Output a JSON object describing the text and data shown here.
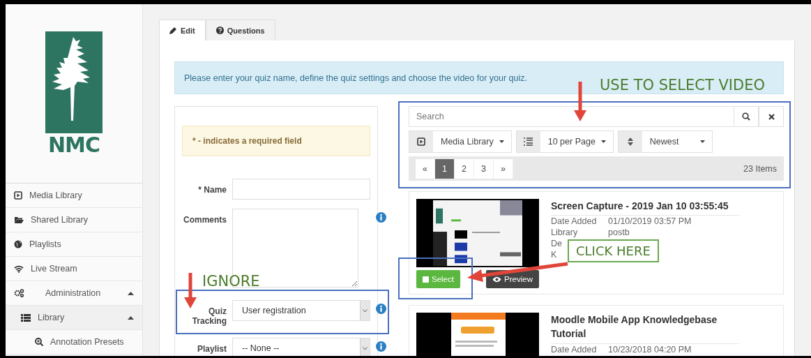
{
  "logo": {
    "text": "NMC"
  },
  "sidebar": {
    "items": [
      {
        "label": "Media Library"
      },
      {
        "label": "Shared Library"
      },
      {
        "label": "Playlists"
      },
      {
        "label": "Live Stream"
      },
      {
        "label": "Administration",
        "expanded": true,
        "children": [
          {
            "label": "Library",
            "expanded": true,
            "children": [
              {
                "label": "Annotation Presets"
              }
            ]
          }
        ]
      }
    ]
  },
  "tabs": [
    {
      "label": "Edit",
      "selected": true
    },
    {
      "label": "Questions",
      "selected": false
    }
  ],
  "alert": "Please enter your quiz name, define the quiz settings and choose the video for your quiz.",
  "form": {
    "required_note": "* - indicates a required field",
    "fields": [
      {
        "kind": "input",
        "label": "* Name",
        "info": false
      },
      {
        "kind": "textarea",
        "label": "Comments",
        "info": true
      },
      {
        "kind": "select",
        "label": "Quiz Tracking",
        "value": "User registration",
        "info": true
      },
      {
        "kind": "select",
        "label": "Playlist",
        "value": "-- None --",
        "info": true
      }
    ]
  },
  "media_browser": {
    "search": {
      "placeholder": "Search"
    },
    "filters": [
      {
        "value": "Media Library"
      },
      {
        "value": "10 per Page"
      },
      {
        "value": "Newest"
      }
    ],
    "pages": [
      {
        "label": "«",
        "selected": false
      },
      {
        "label": "1",
        "selected": true
      },
      {
        "label": "2",
        "selected": false
      },
      {
        "label": "3",
        "selected": false
      },
      {
        "label": "»",
        "selected": false
      }
    ],
    "item_count": "23 Items"
  },
  "media_items": [
    {
      "title": "Screen Capture - 2019 Jan 10 03:55:45",
      "details": [
        {
          "label": "Date Added",
          "value": "01/10/2019 03:57 PM"
        },
        {
          "label": "Library",
          "value": "postb"
        },
        {
          "label": "De"
        },
        {
          "label": "K"
        }
      ],
      "buttons": [
        {
          "kind": "select",
          "label": "Select"
        },
        {
          "kind": "preview",
          "label": "Preview"
        }
      ]
    },
    {
      "title": "Moodle Mobile App Knowledgebase Tutorial",
      "details": [
        {
          "label": "Date Added",
          "value": "10/23/2018 04:20 PM"
        }
      ]
    }
  ],
  "annotations": [
    {
      "text": "USE TO SELECT VIDEO"
    },
    {
      "text": "CLICK HERE"
    },
    {
      "text": "IGNORE"
    }
  ]
}
